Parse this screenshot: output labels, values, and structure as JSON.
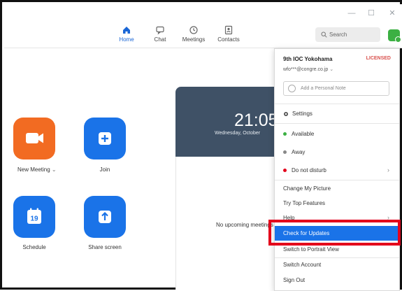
{
  "window": {
    "controls": [
      "—",
      "☐",
      "✕"
    ]
  },
  "nav": {
    "items": [
      {
        "label": "Home",
        "icon": "home-icon",
        "active": true
      },
      {
        "label": "Chat",
        "icon": "chat-icon",
        "active": false
      },
      {
        "label": "Meetings",
        "icon": "clock-icon",
        "active": false
      },
      {
        "label": "Contacts",
        "icon": "contacts-icon",
        "active": false
      }
    ],
    "search_label": "Search"
  },
  "tiles": [
    {
      "label": "New Meeting",
      "icon": "video-camera-icon",
      "color": "#f26b22",
      "has_dropdown": true
    },
    {
      "label": "Join",
      "icon": "plus-icon",
      "color": "#1a73e8"
    },
    {
      "label": "Schedule",
      "icon": "calendar-icon",
      "color": "#1a73e8",
      "day": "19"
    },
    {
      "label": "Share screen",
      "icon": "share-up-arrow-icon",
      "color": "#1a73e8"
    }
  ],
  "calendar": {
    "time": "21:05",
    "date": "Wednesday, October",
    "empty_text": "No upcoming meetings today"
  },
  "menu": {
    "name": "9th IOC Yokohama",
    "license": "LICENSED",
    "email": "wfo***@congre.co.jp",
    "note_placeholder": "Add a Personal Note",
    "settings": "Settings",
    "status": [
      {
        "label": "Available",
        "dot_color": "#3cb043"
      },
      {
        "label": "Away",
        "dot_color": "#888888"
      },
      {
        "label": "Do not disturb",
        "dot_color": "#e3001b"
      }
    ],
    "items": [
      "Change My Picture",
      "Try Top Features",
      "Help",
      "Check for Updates",
      "Switch to Portrait View",
      "Switch Account",
      "Sign Out"
    ],
    "highlighted": "Check for Updates"
  },
  "colors": {
    "accent": "#1a73e8",
    "orange": "#f26b22",
    "callout": "#e3001b"
  }
}
